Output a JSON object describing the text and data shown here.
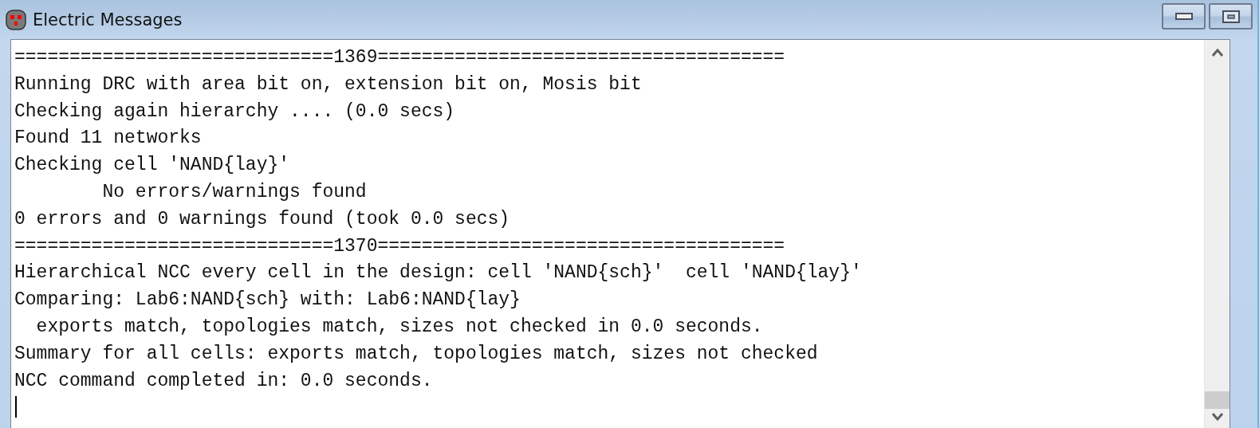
{
  "window": {
    "title": "Electric Messages"
  },
  "messages": [
    "=============================1369=====================================",
    "Running DRC with area bit on, extension bit on, Mosis bit",
    "Checking again hierarchy .... (0.0 secs)",
    "Found 11 networks",
    "Checking cell 'NAND{lay}'",
    "        No errors/warnings found",
    "0 errors and 0 warnings found (took 0.0 secs)",
    "=============================1370=====================================",
    "Hierarchical NCC every cell in the design: cell 'NAND{sch}'  cell 'NAND{lay}'",
    "Comparing: Lab6:NAND{sch} with: Lab6:NAND{lay}",
    "  exports match, topologies match, sizes not checked in 0.0 seconds.",
    "Summary for all cells: exports match, topologies match, sizes not checked",
    "NCC command completed in: 0.0 seconds."
  ]
}
